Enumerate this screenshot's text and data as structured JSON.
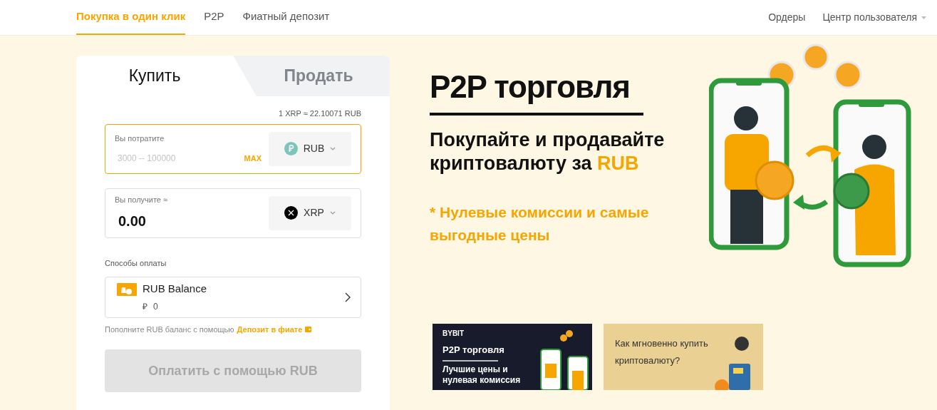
{
  "nav": {
    "tabs": [
      {
        "label": "Покупка в один клик",
        "selected": true
      },
      {
        "label": "P2P",
        "selected": false
      },
      {
        "label": "Фиатный депозит",
        "selected": false
      }
    ],
    "links": [
      "Ордеры",
      "Центр пользователя"
    ]
  },
  "trade_card": {
    "tabs": [
      {
        "label": "Купить",
        "selected": true
      },
      {
        "label": "Продать",
        "selected": false
      }
    ],
    "rate": "1 XRP ≈ 22.10071 RUB",
    "spend": {
      "label": "Вы потратите",
      "placeholder": "3000 -- 100000",
      "max_label": "MAX",
      "currency": "RUB",
      "focused": true
    },
    "receive": {
      "label": "Вы получите ≈",
      "value": "0.00",
      "currency": "XRP",
      "focused": false
    },
    "payment_label": "Способы оплаты",
    "payment_method": {
      "name": "RUB Balance",
      "symbol": "₽",
      "balance": "0"
    },
    "deposit_hint": {
      "text": "Пополните RUB баланс с помощью",
      "link": "Депозит в фиате"
    },
    "pay_button": {
      "label": "Оплатить с помощью RUB",
      "disabled": true
    }
  },
  "hero": {
    "title": "P2P торговля",
    "subtitle": "Покупайте и продавайте криптовалюту за",
    "subtitle_highlight": "RUB",
    "note": "* Нулевые комиссии и самые выгодные цены"
  },
  "banners": [
    {
      "kind": "dark",
      "logo": "BYBIT",
      "title": "P2P торговля",
      "text": "Лучшие цены и нулевая комиссия"
    },
    {
      "kind": "light",
      "title": "Как мгновенно купить криптовалюту?"
    }
  ]
}
